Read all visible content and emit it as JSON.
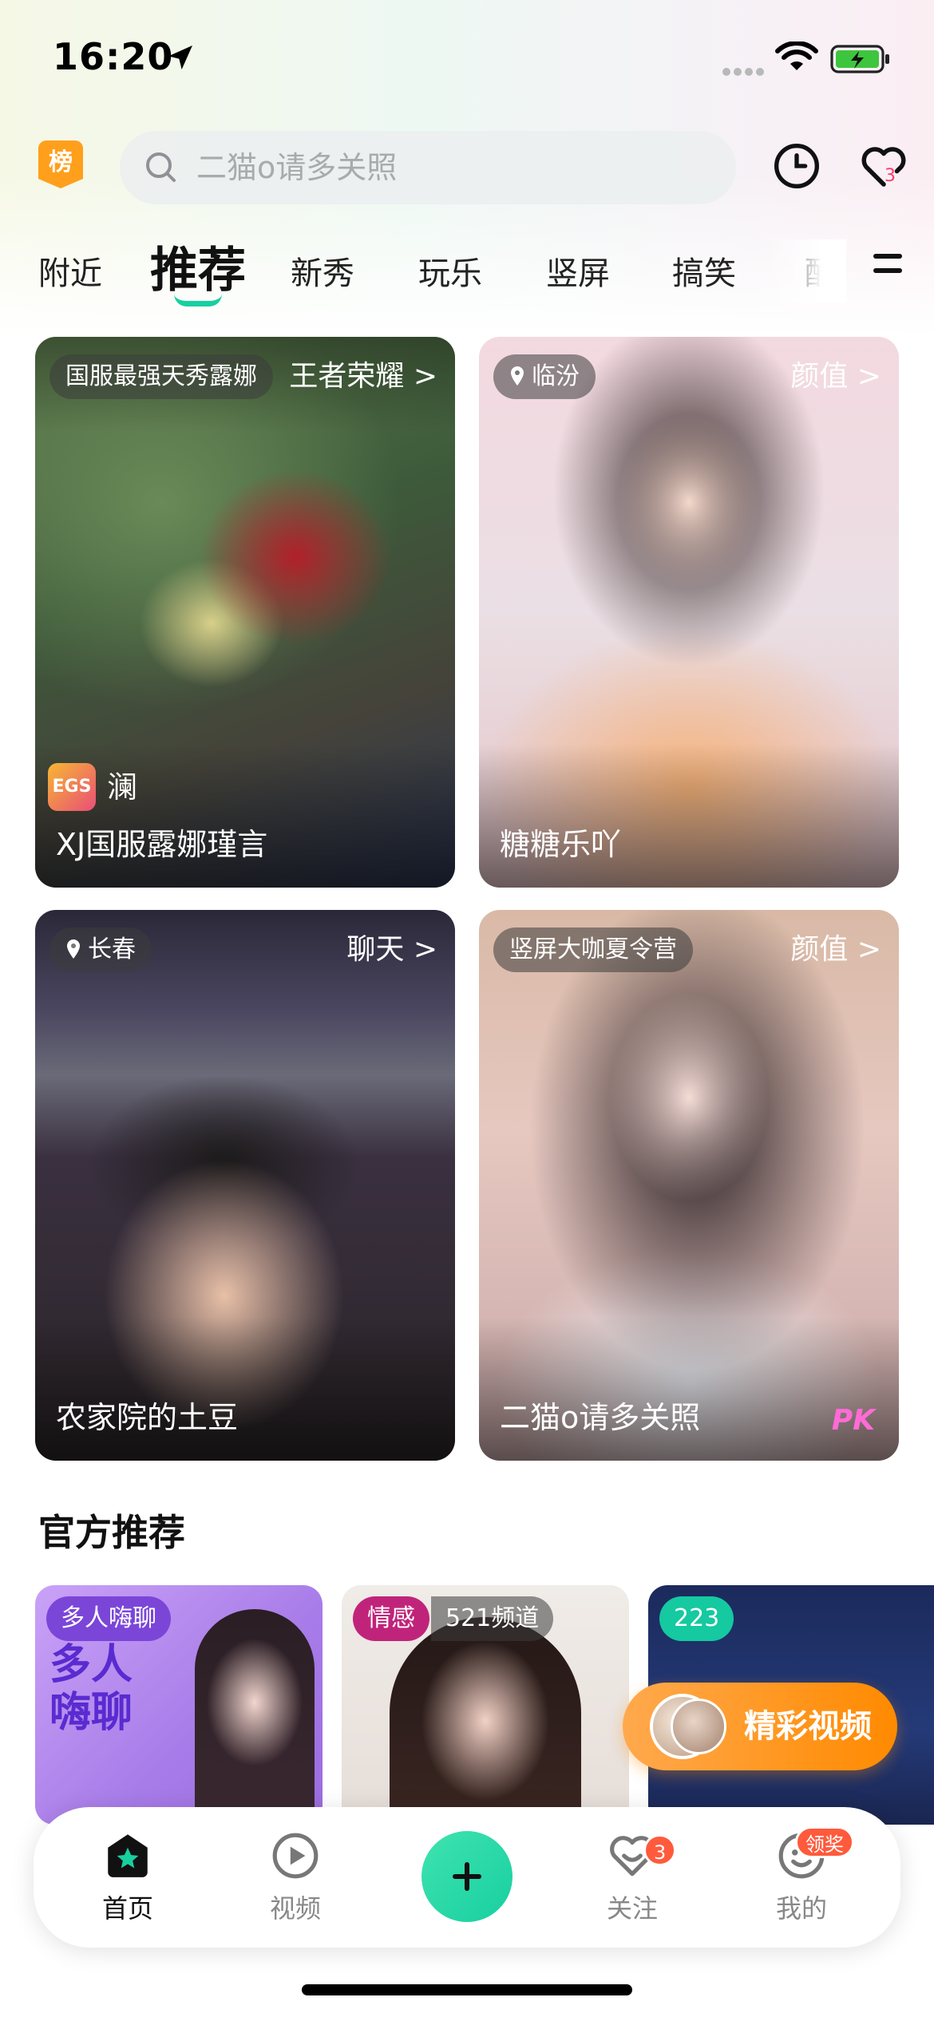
{
  "status_bar": {
    "time": "16:20"
  },
  "header": {
    "rank_badge": "榜",
    "search_placeholder": "二猫o请多关照",
    "fav_count": "3"
  },
  "tabs": [
    {
      "label": "附近"
    },
    {
      "label": "推荐",
      "active": true
    },
    {
      "label": "新秀"
    },
    {
      "label": "玩乐"
    },
    {
      "label": "竖屏"
    },
    {
      "label": "搞笑"
    },
    {
      "label": "酷"
    }
  ],
  "live_cards": [
    {
      "tag": "国服最强天秀露娜",
      "category": "王者荣耀",
      "category_arrow": ">",
      "sub_logo": "EGS",
      "sub_text": "澜",
      "name": "XJ国服露娜瑾言"
    },
    {
      "tag": "临汾",
      "category": "颜值",
      "category_arrow": ">",
      "name": "糖糖乐吖"
    },
    {
      "tag": "长春",
      "category": "聊天",
      "category_arrow": ">",
      "name": "农家院的土豆"
    },
    {
      "tag": "竖屏大咖夏令营",
      "category": "颜值",
      "category_arrow": ">",
      "name": "二猫o请多关照",
      "badge": "PK"
    }
  ],
  "official": {
    "title": "官方推荐",
    "cards": [
      {
        "tag": "多人嗨聊",
        "art_text": "多人嗨聊"
      },
      {
        "tag": "情感",
        "tag2": "521频道"
      },
      {
        "tag": "223"
      }
    ]
  },
  "float_button": {
    "label": "精彩视频"
  },
  "bottom_nav": {
    "items": [
      {
        "label": "首页",
        "active": true
      },
      {
        "label": "视频"
      },
      {
        "label": "关注",
        "badge": "3"
      },
      {
        "label": "我的",
        "badge": "领奖"
      }
    ]
  },
  "colors": {
    "accent": "#18cfa0",
    "badge_red": "#ff5a3c",
    "float_orange": "#ff8a00"
  }
}
